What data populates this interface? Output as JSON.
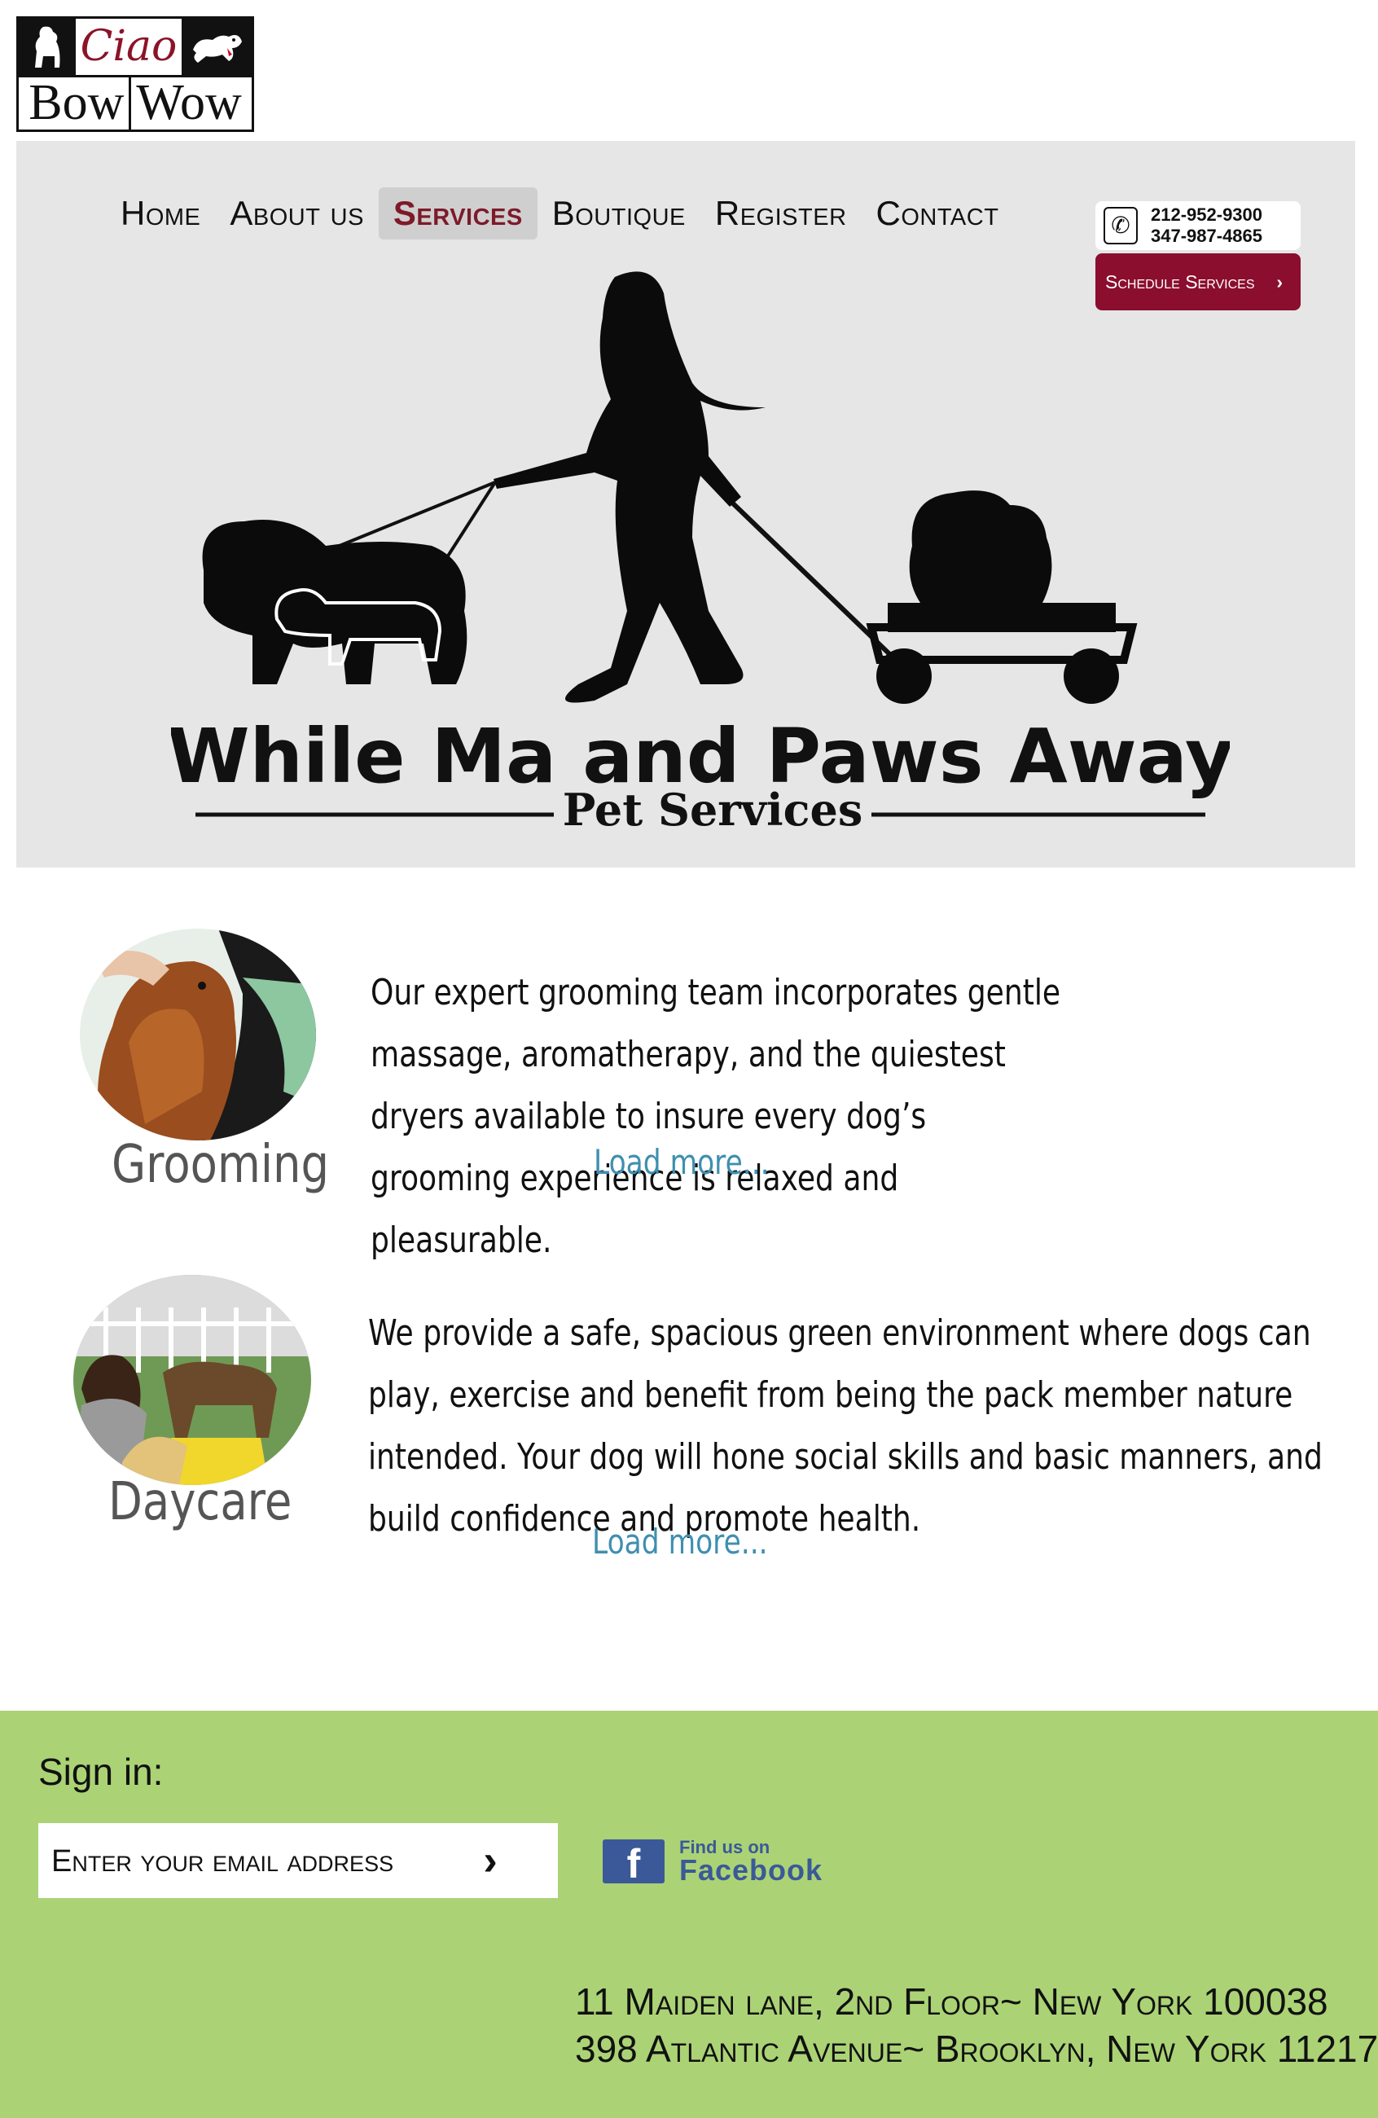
{
  "logo": {
    "word1": "Ciao",
    "word2": "Bow",
    "word3": "Wow"
  },
  "nav": {
    "items": [
      {
        "label": "Home"
      },
      {
        "label": "About us"
      },
      {
        "label": "Services"
      },
      {
        "label": "Boutique"
      },
      {
        "label": "Register"
      },
      {
        "label": "Contact"
      }
    ],
    "active": "Services"
  },
  "contact": {
    "phone1": "212-952-9300",
    "phone2": "347-987-4865"
  },
  "schedule_button": {
    "label": "Schedule Services",
    "icon": "chevron-right-icon"
  },
  "hero": {
    "title": "While Ma and Paws Away",
    "subtitle": "Pet Services"
  },
  "services": [
    {
      "title": "Grooming",
      "text": "Our expert grooming team incorporates gentle massage, aromatherapy, and the quiestest dryers available to insure every dog’s grooming experience is relaxed and pleasurable.",
      "load_more": "Load more..."
    },
    {
      "title": "Daycare",
      "text": "We provide a safe, spacious green environment where dogs can play, exercise and benefit from being the pack member nature intended. Your dog will hone social skills and basic manners, and build confidence and promote health.",
      "load_more": "Load more..."
    }
  ],
  "footer": {
    "signin_label": "Sign in:",
    "email_placeholder": "Enter your email address",
    "facebook_small": "Find us on",
    "facebook_big": "Facebook",
    "address1": "11 Maiden lane, 2nd Floor~ New York 100038",
    "address2": "398 Atlantic Avenue~ Brooklyn, New York 11217"
  },
  "colors": {
    "accent": "#8b0e2e",
    "footer_bg": "#abd375",
    "hero_bg": "#e6e6e6",
    "link": "#3f8fb0",
    "facebook": "#3b5998"
  }
}
